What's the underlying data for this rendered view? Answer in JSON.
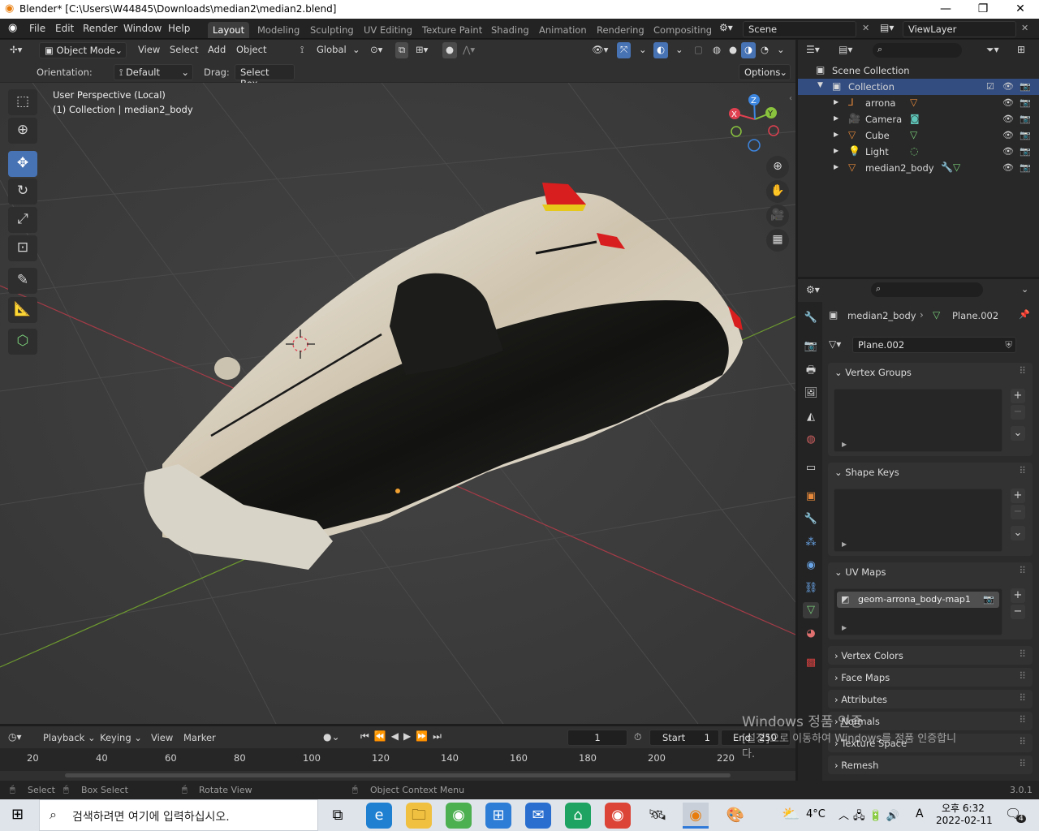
{
  "window": {
    "title": "Blender* [C:\\Users\\W44845\\Downloads\\median2\\median2.blend]",
    "minimize": "—",
    "maximize": "❐",
    "close": "✕"
  },
  "menu": {
    "items": [
      "File",
      "Edit",
      "Render",
      "Window",
      "Help"
    ]
  },
  "workspaces": [
    "Layout",
    "Modeling",
    "Sculpting",
    "UV Editing",
    "Texture Paint",
    "Shading",
    "Animation",
    "Rendering",
    "Compositing"
  ],
  "active_workspace": "Layout",
  "scene": {
    "name": "Scene",
    "view_layer": "ViewLayer"
  },
  "header": {
    "mode": "Object Mode",
    "view": "View",
    "select": "Select",
    "add": "Add",
    "object": "Object",
    "transform_orientation": "Global"
  },
  "tool_settings": {
    "orientation_label": "Orientation:",
    "orientation_value": "Default",
    "drag_label": "Drag:",
    "drag_value": "Select Box",
    "options": "Options"
  },
  "viewport": {
    "perspective_label": "User Perspective (Local)",
    "collection_label": "(1) Collection | median2_body",
    "gizmo": {
      "x": "X",
      "y": "Y",
      "z": "Z"
    }
  },
  "outliner": {
    "root": "Scene Collection",
    "collection": "Collection",
    "items": [
      {
        "name": "arrona",
        "icon": "armature-icon",
        "color": "#e6893a"
      },
      {
        "name": "Camera",
        "icon": "camera-icon",
        "color": "#e6893a"
      },
      {
        "name": "Cube",
        "icon": "mesh-icon",
        "color": "#e6893a"
      },
      {
        "name": "Light",
        "icon": "light-icon",
        "color": "#e6893a"
      },
      {
        "name": "median2_body",
        "icon": "mesh-icon",
        "color": "#e6893a"
      }
    ]
  },
  "properties": {
    "object_name": "median2_body",
    "data_name": "Plane.002",
    "datablock": "Plane.002",
    "panels": {
      "vertex_groups": "Vertex Groups",
      "shape_keys": "Shape Keys",
      "uv_maps": "UV Maps",
      "uv_map_item": "geom-arrona_body-map1",
      "vertex_colors": "Vertex Colors",
      "face_maps": "Face Maps",
      "attributes": "Attributes",
      "normals": "Normals",
      "texture_space": "Texture Space",
      "remesh": "Remesh"
    }
  },
  "timeline": {
    "playback": "Playback",
    "keying": "Keying",
    "view": "View",
    "marker": "Marker",
    "current_frame": "1",
    "start_label": "Start",
    "start": "1",
    "end_label": "End",
    "end": "250",
    "ruler": [
      "20",
      "40",
      "60",
      "80",
      "100",
      "120",
      "140",
      "160",
      "180",
      "200",
      "220"
    ]
  },
  "statusbar": {
    "select": "Select",
    "box_select": "Box Select",
    "rotate_view": "Rotate View",
    "context_menu": "Object Context Menu",
    "version": "3.0.1"
  },
  "watermark": {
    "line1": "Windows 정품 인증",
    "line2": "[설정]으로 이동하여 Windows를 정품 인증합니",
    "line3": "다."
  },
  "taskbar": {
    "search_placeholder": "검색하려면 여기에 입력하십시오.",
    "weather": "4°C",
    "ime": "A",
    "time": "오후 6:32",
    "date": "2022-02-11",
    "notification_count": "4"
  }
}
